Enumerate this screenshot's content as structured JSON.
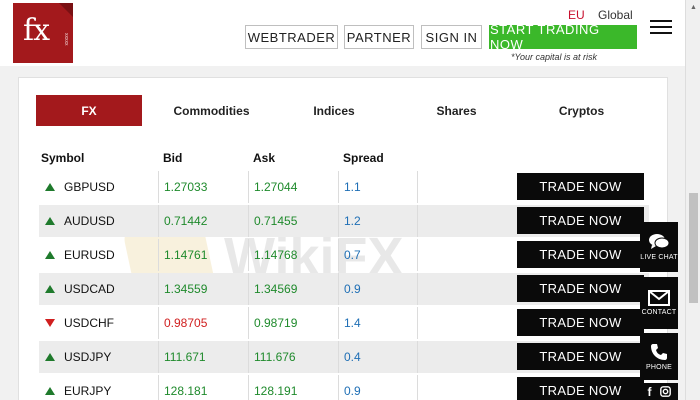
{
  "header": {
    "logo_text": "fx",
    "logo_small": "xxxxx",
    "region_eu": "EU",
    "region_global": "Global",
    "nav": {
      "webtrader": "WEBTRADER",
      "partner": "PARTNER",
      "signin": "SIGN IN",
      "start": "START TRADING NOW"
    },
    "risk_note": "*Your capital is at risk"
  },
  "tabs": [
    {
      "label": "FX",
      "active": true
    },
    {
      "label": "Commodities"
    },
    {
      "label": "Indices"
    },
    {
      "label": "Shares"
    },
    {
      "label": "Cryptos"
    }
  ],
  "columns": {
    "symbol": "Symbol",
    "bid": "Bid",
    "ask": "Ask",
    "spread": "Spread"
  },
  "rows": [
    {
      "symbol": "GBPUSD",
      "bid": "1.27033",
      "ask": "1.27044",
      "spread": "1.1",
      "direction": "up",
      "trade": "TRADE NOW"
    },
    {
      "symbol": "AUDUSD",
      "bid": "0.71442",
      "ask": "0.71455",
      "spread": "1.2",
      "direction": "up",
      "trade": "TRADE NOW"
    },
    {
      "symbol": "EURUSD",
      "bid": "1.14761",
      "ask": "1.14768",
      "spread": "0.7",
      "direction": "up",
      "trade": "TRADE NOW"
    },
    {
      "symbol": "USDCAD",
      "bid": "1.34559",
      "ask": "1.34569",
      "spread": "0.9",
      "direction": "up",
      "trade": "TRADE NOW"
    },
    {
      "symbol": "USDCHF",
      "bid": "0.98705",
      "ask": "0.98719",
      "spread": "1.4",
      "direction": "down",
      "trade": "TRADE NOW"
    },
    {
      "symbol": "USDJPY",
      "bid": "111.671",
      "ask": "111.676",
      "spread": "0.4",
      "direction": "up",
      "trade": "TRADE NOW"
    },
    {
      "symbol": "EURJPY",
      "bid": "128.181",
      "ask": "128.191",
      "spread": "0.9",
      "direction": "up",
      "trade": "TRADE NOW"
    }
  ],
  "side": {
    "live_chat": "LIVE CHAT",
    "contact": "CONTACT",
    "phone": "PHONE"
  },
  "watermark": "WikiFX",
  "colors": {
    "brand_red": "#a3191c",
    "cta_green": "#3bb82a",
    "up_green": "#1f7a2c",
    "down_red": "#d01f1f",
    "spread_blue": "#1f6fb5"
  }
}
